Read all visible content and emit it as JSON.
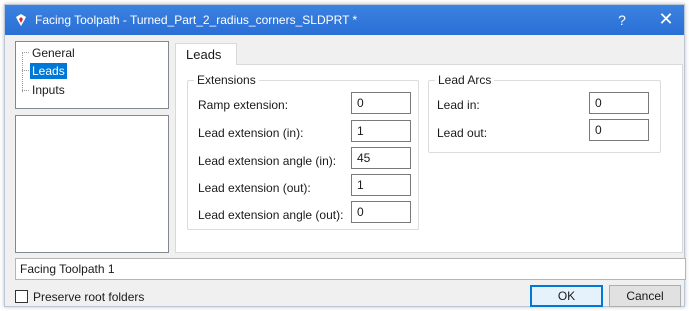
{
  "window": {
    "title": "Facing Toolpath - Turned_Part_2_radius_corners_SLDPRT *",
    "help_label": "?",
    "close_label": "✕",
    "app_icon": "solidworks-logo-icon"
  },
  "tree": {
    "items": [
      {
        "label": "General"
      },
      {
        "label": "Leads",
        "selected": true
      },
      {
        "label": "Inputs"
      }
    ]
  },
  "tab": {
    "label": "Leads"
  },
  "extensions": {
    "title": "Extensions",
    "fields": [
      {
        "label": "Ramp extension:",
        "value": "0"
      },
      {
        "label": "Lead extension (in):",
        "value": "1"
      },
      {
        "label": "Lead extension angle (in):",
        "value": "45"
      },
      {
        "label": "Lead extension (out):",
        "value": "1"
      },
      {
        "label": "Lead extension angle (out):",
        "value": "0"
      }
    ]
  },
  "lead_arcs": {
    "title": "Lead Arcs",
    "fields": [
      {
        "label": "Lead in:",
        "value": "0"
      },
      {
        "label": "Lead out:",
        "value": "0"
      }
    ]
  },
  "name_field": {
    "value": "Facing Toolpath 1"
  },
  "preserve": {
    "label": "Preserve root folders",
    "checked": false
  },
  "buttons": {
    "ok": "OK",
    "cancel": "Cancel"
  },
  "colors": {
    "titlebar": "#2a6fd6",
    "selection": "#0078d7"
  }
}
